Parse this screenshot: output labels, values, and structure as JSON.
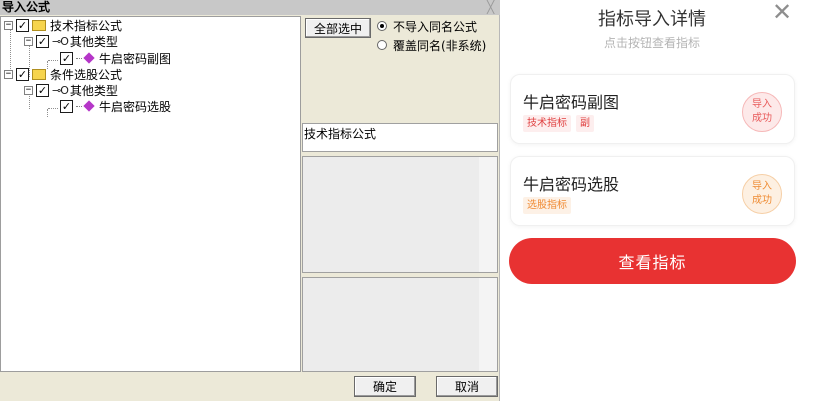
{
  "dialog": {
    "title": "导入公式",
    "close_glyph": "╳",
    "tree": [
      {
        "label": "技术指标公式",
        "checked": "✓",
        "expander": "−"
      },
      {
        "label": "其他类型",
        "checked": "✓",
        "expander": "−",
        "icon": "⊸O"
      },
      {
        "label": "牛启密码副图",
        "checked": "✓"
      },
      {
        "label": "条件选股公式",
        "checked": "✓",
        "expander": "−"
      },
      {
        "label": "其他类型",
        "checked": "✓",
        "expander": "−",
        "icon": "⊸O"
      },
      {
        "label": "牛启密码选股",
        "checked": "✓"
      }
    ],
    "select_all_label": "全部选中",
    "options": [
      {
        "label": "不导入同名公式",
        "selected": true
      },
      {
        "label": "覆盖同名(非系统)",
        "selected": false
      }
    ],
    "info_text": "技术指标公式",
    "ok_label": "确定",
    "cancel_label": "取消"
  },
  "card": {
    "title": "指标导入详情",
    "subtitle": "点击按钮查看指标",
    "close_glyph": "✕",
    "results": [
      {
        "name": "牛启密码副图",
        "tags": [
          {
            "text": "技术指标",
            "color": "#e04040"
          },
          {
            "text": "副",
            "color": "#e04040"
          }
        ],
        "status_line1": "导入",
        "status_line2": "成功",
        "status_color": "#e85a5a"
      },
      {
        "name": "牛启密码选股",
        "tags": [
          {
            "text": "选股指标",
            "color": "#f08a33"
          }
        ],
        "status_line1": "导入",
        "status_line2": "成功",
        "status_color": "#ef8c34"
      }
    ],
    "view_button_label": "查看指标",
    "accent": "#e83232"
  }
}
